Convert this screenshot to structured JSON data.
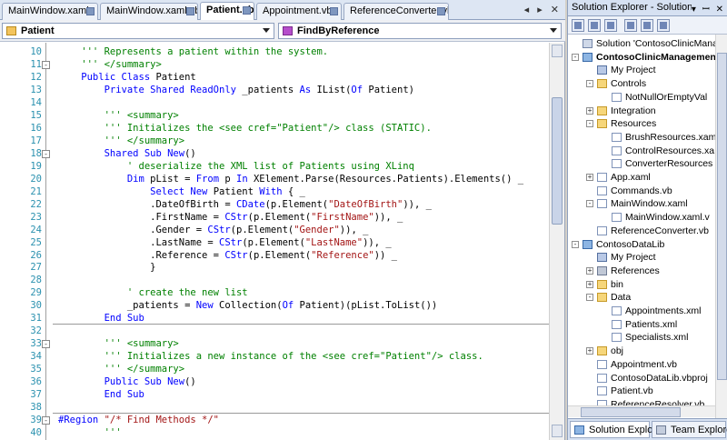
{
  "editor": {
    "tabs": [
      {
        "label": "MainWindow.xaml",
        "active": false
      },
      {
        "label": "MainWindow.xaml.vb",
        "active": false
      },
      {
        "label": "Patient.vb",
        "active": true
      },
      {
        "label": "Appointment.vb",
        "active": false
      },
      {
        "label": "ReferenceConverter.vb",
        "active": false
      }
    ],
    "tab_controls": "◂ ▸ ✕",
    "class_combo": "Patient",
    "member_combo": "FindByReference",
    "lines": [
      {
        "num": "10",
        "parts": [
          [
            "cm",
            "    ''' Represents a patient within the system."
          ]
        ]
      },
      {
        "num": "11",
        "parts": [
          [
            "cm",
            "    ''' </summary>"
          ]
        ]
      },
      {
        "num": "12",
        "parts": [
          [
            "kw",
            "    Public Class "
          ],
          [
            "tx",
            "Patient"
          ]
        ]
      },
      {
        "num": "13",
        "parts": [
          [
            "kw",
            "        Private Shared ReadOnly "
          ],
          [
            "tx",
            "_patients "
          ],
          [
            "kw",
            "As "
          ],
          [
            "tx",
            "IList("
          ],
          [
            "kw",
            "Of "
          ],
          [
            "tx",
            "Patient)"
          ]
        ]
      },
      {
        "num": "14",
        "parts": [
          [
            "tx",
            ""
          ]
        ]
      },
      {
        "num": "15",
        "parts": [
          [
            "cm",
            "        ''' <summary>"
          ]
        ]
      },
      {
        "num": "16",
        "parts": [
          [
            "cm",
            "        ''' Initializes the <see cref=\"Patient\"/> class (STATIC)."
          ]
        ]
      },
      {
        "num": "17",
        "parts": [
          [
            "cm",
            "        ''' </summary>"
          ]
        ]
      },
      {
        "num": "18",
        "parts": [
          [
            "kw",
            "        Shared Sub New"
          ],
          [
            "tx",
            "()"
          ]
        ]
      },
      {
        "num": "19",
        "parts": [
          [
            "cm",
            "            ' deserialize the XML list of Patients using XLinq"
          ]
        ]
      },
      {
        "num": "20",
        "parts": [
          [
            "kw",
            "            Dim "
          ],
          [
            "tx",
            "pList = "
          ],
          [
            "kw",
            "From "
          ],
          [
            "tx",
            "p "
          ],
          [
            "kw",
            "In "
          ],
          [
            "tx",
            "XElement.Parse(Resources.Patients).Elements() _"
          ]
        ]
      },
      {
        "num": "21",
        "parts": [
          [
            "kw",
            "                Select New "
          ],
          [
            "tx",
            "Patient "
          ],
          [
            "kw",
            "With "
          ],
          [
            "tx",
            "{ _"
          ]
        ]
      },
      {
        "num": "22",
        "parts": [
          [
            "tx",
            "                .DateOfBirth = "
          ],
          [
            "kw",
            "CDate"
          ],
          [
            "tx",
            "(p.Element("
          ],
          [
            "st",
            "\"DateOfBirth\""
          ],
          [
            "tx",
            ")), _"
          ]
        ]
      },
      {
        "num": "23",
        "parts": [
          [
            "tx",
            "                .FirstName = "
          ],
          [
            "kw",
            "CStr"
          ],
          [
            "tx",
            "(p.Element("
          ],
          [
            "st",
            "\"FirstName\""
          ],
          [
            "tx",
            ")), _"
          ]
        ]
      },
      {
        "num": "24",
        "parts": [
          [
            "tx",
            "                .Gender = "
          ],
          [
            "kw",
            "CStr"
          ],
          [
            "tx",
            "(p.Element("
          ],
          [
            "st",
            "\"Gender\""
          ],
          [
            "tx",
            ")), _"
          ]
        ]
      },
      {
        "num": "25",
        "parts": [
          [
            "tx",
            "                .LastName = "
          ],
          [
            "kw",
            "CStr"
          ],
          [
            "tx",
            "(p.Element("
          ],
          [
            "st",
            "\"LastName\""
          ],
          [
            "tx",
            ")), _"
          ]
        ]
      },
      {
        "num": "26",
        "parts": [
          [
            "tx",
            "                .Reference = "
          ],
          [
            "kw",
            "CStr"
          ],
          [
            "tx",
            "(p.Element("
          ],
          [
            "st",
            "\"Reference\""
          ],
          [
            "tx",
            ")) _"
          ]
        ]
      },
      {
        "num": "27",
        "parts": [
          [
            "tx",
            "                }"
          ]
        ]
      },
      {
        "num": "28",
        "parts": [
          [
            "tx",
            ""
          ]
        ]
      },
      {
        "num": "29",
        "parts": [
          [
            "cm",
            "            ' create the new list"
          ]
        ]
      },
      {
        "num": "30",
        "parts": [
          [
            "tx",
            "            _patients = "
          ],
          [
            "kw",
            "New "
          ],
          [
            "tx",
            "Collection("
          ],
          [
            "kw",
            "Of "
          ],
          [
            "tx",
            "Patient)(pList.ToList())"
          ]
        ]
      },
      {
        "num": "31",
        "parts": [
          [
            "kw",
            "        End Sub"
          ]
        ]
      },
      {
        "num": "32",
        "parts": [
          [
            "tx",
            ""
          ]
        ]
      },
      {
        "num": "33",
        "parts": [
          [
            "cm",
            "        ''' <summary>"
          ]
        ]
      },
      {
        "num": "34",
        "parts": [
          [
            "cm",
            "        ''' Initializes a new instance of the <see cref=\"Patient\"/> class."
          ]
        ]
      },
      {
        "num": "35",
        "parts": [
          [
            "cm",
            "        ''' </summary>"
          ]
        ]
      },
      {
        "num": "36",
        "parts": [
          [
            "kw",
            "        Public Sub New"
          ],
          [
            "tx",
            "()"
          ]
        ]
      },
      {
        "num": "37",
        "parts": [
          [
            "kw",
            "        End Sub"
          ]
        ]
      },
      {
        "num": "38",
        "parts": [
          [
            "tx",
            ""
          ]
        ]
      },
      {
        "num": "39",
        "parts": [
          [
            "kw",
            "#Region "
          ],
          [
            "st",
            "\"/* Find Methods */\""
          ]
        ]
      },
      {
        "num": "40",
        "parts": [
          [
            "cm",
            "        '''"
          ]
        ]
      }
    ]
  },
  "solution_explorer": {
    "title": "Solution Explorer - Solution...",
    "title_controls": "▾ ꟷ ✕",
    "tree": [
      {
        "label": "Solution 'ContosoClinicManag",
        "depth": 0,
        "icon": "solution",
        "exp": "",
        "bold": false
      },
      {
        "label": "ContosoClinicManagemen",
        "depth": 0,
        "icon": "project",
        "exp": "-",
        "bold": true
      },
      {
        "label": "My Project",
        "depth": 1,
        "icon": "myproj",
        "exp": "",
        "bold": false
      },
      {
        "label": "Controls",
        "depth": 1,
        "icon": "folder",
        "exp": "-",
        "bold": false
      },
      {
        "label": "NotNullOrEmptyVal",
        "depth": 2,
        "icon": "file",
        "exp": "",
        "bold": false
      },
      {
        "label": "Integration",
        "depth": 1,
        "icon": "folder",
        "exp": "+",
        "bold": false
      },
      {
        "label": "Resources",
        "depth": 1,
        "icon": "folder",
        "exp": "-",
        "bold": false
      },
      {
        "label": "BrushResources.xam",
        "depth": 2,
        "icon": "file",
        "exp": "",
        "bold": false
      },
      {
        "label": "ControlResources.xa",
        "depth": 2,
        "icon": "file",
        "exp": "",
        "bold": false
      },
      {
        "label": "ConverterResources",
        "depth": 2,
        "icon": "file",
        "exp": "",
        "bold": false
      },
      {
        "label": "App.xaml",
        "depth": 1,
        "icon": "file",
        "exp": "+",
        "bold": false
      },
      {
        "label": "Commands.vb",
        "depth": 1,
        "icon": "file",
        "exp": "",
        "bold": false
      },
      {
        "label": "MainWindow.xaml",
        "depth": 1,
        "icon": "file",
        "exp": "-",
        "bold": false
      },
      {
        "label": "MainWindow.xaml.v",
        "depth": 2,
        "icon": "file",
        "exp": "",
        "bold": false
      },
      {
        "label": "ReferenceConverter.vb",
        "depth": 1,
        "icon": "file",
        "exp": "",
        "bold": false
      },
      {
        "label": "ContosoDataLib",
        "depth": 0,
        "icon": "project",
        "exp": "-",
        "bold": false
      },
      {
        "label": "My Project",
        "depth": 1,
        "icon": "myproj",
        "exp": "",
        "bold": false
      },
      {
        "label": "References",
        "depth": 1,
        "icon": "ref",
        "exp": "+",
        "bold": false
      },
      {
        "label": "bin",
        "depth": 1,
        "icon": "folder",
        "exp": "+",
        "bold": false
      },
      {
        "label": "Data",
        "depth": 1,
        "icon": "folder",
        "exp": "-",
        "bold": false
      },
      {
        "label": "Appointments.xml",
        "depth": 2,
        "icon": "file",
        "exp": "",
        "bold": false
      },
      {
        "label": "Patients.xml",
        "depth": 2,
        "icon": "file",
        "exp": "",
        "bold": false
      },
      {
        "label": "Specialists.xml",
        "depth": 2,
        "icon": "file",
        "exp": "",
        "bold": false
      },
      {
        "label": "obj",
        "depth": 1,
        "icon": "folder",
        "exp": "+",
        "bold": false
      },
      {
        "label": "Appointment.vb",
        "depth": 1,
        "icon": "file",
        "exp": "",
        "bold": false
      },
      {
        "label": "ContosoDataLib.vbproj",
        "depth": 1,
        "icon": "file",
        "exp": "",
        "bold": false
      },
      {
        "label": "Patient.vb",
        "depth": 1,
        "icon": "file",
        "exp": "",
        "bold": false
      },
      {
        "label": "ReferenceResolver.vb",
        "depth": 1,
        "icon": "file",
        "exp": "",
        "bold": false
      }
    ],
    "bottom_tabs": [
      {
        "label": "Solution Explo...",
        "active": true
      },
      {
        "label": "Team Explorer",
        "active": false
      }
    ]
  }
}
